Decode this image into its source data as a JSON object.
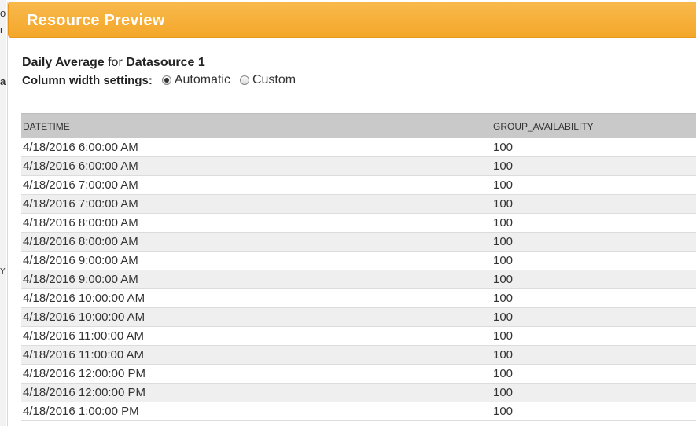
{
  "header": {
    "title": "Resource Preview"
  },
  "subtitle": {
    "metric": "Daily Average",
    "connector": "for",
    "datasource": "Datasource 1"
  },
  "column_width": {
    "label": "Column width settings:",
    "options": [
      {
        "label": "Automatic",
        "checked": true
      },
      {
        "label": "Custom",
        "checked": false
      }
    ]
  },
  "table": {
    "columns": [
      "DATETIME",
      "GROUP_AVAILABILITY"
    ],
    "rows": [
      [
        "4/18/2016 6:00:00 AM",
        "100"
      ],
      [
        "4/18/2016 6:00:00 AM",
        "100"
      ],
      [
        "4/18/2016 7:00:00 AM",
        "100"
      ],
      [
        "4/18/2016 7:00:00 AM",
        "100"
      ],
      [
        "4/18/2016 8:00:00 AM",
        "100"
      ],
      [
        "4/18/2016 8:00:00 AM",
        "100"
      ],
      [
        "4/18/2016 9:00:00 AM",
        "100"
      ],
      [
        "4/18/2016 9:00:00 AM",
        "100"
      ],
      [
        "4/18/2016 10:00:00 AM",
        "100"
      ],
      [
        "4/18/2016 10:00:00 AM",
        "100"
      ],
      [
        "4/18/2016 11:00:00 AM",
        "100"
      ],
      [
        "4/18/2016 11:00:00 AM",
        "100"
      ],
      [
        "4/18/2016 12:00:00 PM",
        "100"
      ],
      [
        "4/18/2016 12:00:00 PM",
        "100"
      ],
      [
        "4/18/2016 1:00:00 PM",
        "100"
      ]
    ]
  },
  "background_fragments": [
    "o",
    "r",
    "a",
    "Y"
  ]
}
